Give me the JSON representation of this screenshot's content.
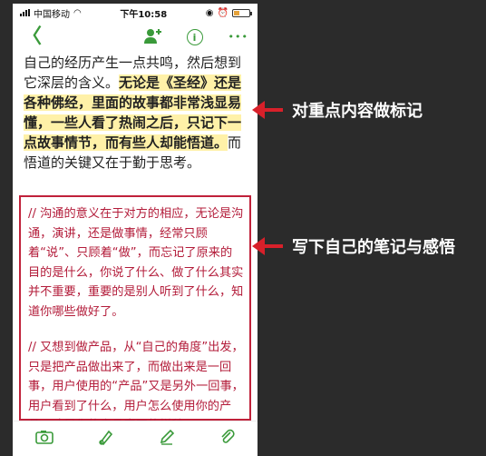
{
  "status": {
    "carrier": "中国移动",
    "time": "下午10:58"
  },
  "toolbar": {
    "back_icon": "back-chevron-icon",
    "add_user_icon": "add-user-icon",
    "info_icon": "info-icon",
    "more_icon": "more-icon",
    "info_label": "i",
    "more_label": "•••",
    "back_label": "〈"
  },
  "content": {
    "p1": "自己的经历产生一点共鸣，然后想到它深层的含义。",
    "highlight": "无论是《圣经》还是各种佛经，里面的故事都非常浅显易懂，一些人看了热闹之后，只记下一点故事情节，而有些人却能悟道。",
    "p1_tail": "而悟道的关键又在于勤于思考。"
  },
  "notes": {
    "n1": "// 沟通的意义在于对方的相应，无论是沟通，演讲，还是做事情，经常只顾着“说”、只顾着“做”，而忘记了原来的目的是什么，你说了什么、做了什么其实并不重要，重要的是别人听到了什么，知道你哪些做好了。",
    "n2": "// 又想到做产品，从“自己的角度”出发，只是把产品做出来了，而做出来是一回事，用户使用的“产品”又是另外一回事，用户看到了什么，用户怎么使用你的产品，才是你的产品真正的样貌。"
  },
  "callouts": {
    "top": "对重点内容做标记",
    "bottom": "写下自己的笔记与感悟"
  },
  "bottombar": {
    "camera": "📷",
    "pen": "✎",
    "edit": "✐",
    "clip": "📎"
  },
  "colors": {
    "accent": "#3a9a3a",
    "highlight": "#fff1a8",
    "note": "#b31c3a",
    "arrow": "#d8202a"
  }
}
